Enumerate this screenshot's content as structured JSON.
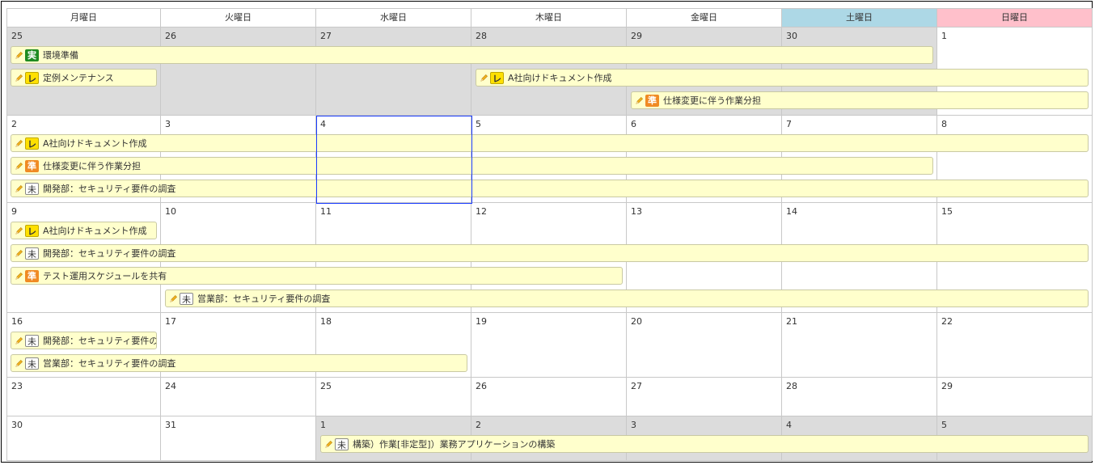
{
  "weekdays": [
    "月曜日",
    "火曜日",
    "水曜日",
    "木曜日",
    "金曜日",
    "土曜日",
    "日曜日"
  ],
  "colors": {
    "saturday": "#add8e6",
    "sunday": "#ffc0cb",
    "event_bg": "#ffffcc",
    "other_month": "#dcdcdc",
    "today_border": "#1a3cff"
  },
  "weeks": [
    {
      "days": [
        "25",
        "26",
        "27",
        "28",
        "29",
        "30",
        "1"
      ],
      "other": [
        true,
        true,
        true,
        true,
        true,
        true,
        false
      ]
    },
    {
      "days": [
        "2",
        "3",
        "4",
        "5",
        "6",
        "7",
        "8"
      ],
      "other": [
        false,
        false,
        false,
        false,
        false,
        false,
        false
      ]
    },
    {
      "days": [
        "9",
        "10",
        "11",
        "12",
        "13",
        "14",
        "15"
      ],
      "other": [
        false,
        false,
        false,
        false,
        false,
        false,
        false
      ]
    },
    {
      "days": [
        "16",
        "17",
        "18",
        "19",
        "20",
        "21",
        "22"
      ],
      "other": [
        false,
        false,
        false,
        false,
        false,
        false,
        false
      ]
    },
    {
      "days": [
        "23",
        "24",
        "25",
        "26",
        "27",
        "28",
        "29"
      ],
      "other": [
        false,
        false,
        false,
        false,
        false,
        false,
        false
      ]
    },
    {
      "days": [
        "30",
        "31",
        "1",
        "2",
        "3",
        "4",
        "5"
      ],
      "other": [
        false,
        false,
        true,
        true,
        true,
        true,
        true
      ]
    }
  ],
  "today": {
    "week": 1,
    "day": 2
  },
  "status_labels": {
    "jitsu": "実",
    "re": "レ",
    "jun": "準",
    "mi": "未"
  },
  "events": [
    {
      "week": 0,
      "lane": 0,
      "start": 0,
      "end": 5,
      "status": "jitsu",
      "title": "環境準備"
    },
    {
      "week": 0,
      "lane": 1,
      "start": 0,
      "end": 0,
      "status": "re",
      "title": "定例メンテナンス"
    },
    {
      "week": 0,
      "lane": 1,
      "start": 3,
      "end": 6,
      "status": "re",
      "title": "A社向けドキュメント作成"
    },
    {
      "week": 0,
      "lane": 2,
      "start": 4,
      "end": 6,
      "status": "jun",
      "title": "仕様変更に伴う作業分担"
    },
    {
      "week": 1,
      "lane": 0,
      "start": 0,
      "end": 6,
      "status": "re",
      "title": "A社向けドキュメント作成"
    },
    {
      "week": 1,
      "lane": 1,
      "start": 0,
      "end": 5,
      "status": "jun",
      "title": "仕様変更に伴う作業分担"
    },
    {
      "week": 1,
      "lane": 2,
      "start": 0,
      "end": 6,
      "status": "mi",
      "title": "開発部：セキュリティ要件の調査"
    },
    {
      "week": 2,
      "lane": 0,
      "start": 0,
      "end": 0,
      "status": "re",
      "title": "A社向けドキュメント作成"
    },
    {
      "week": 2,
      "lane": 1,
      "start": 0,
      "end": 6,
      "status": "mi",
      "title": "開発部：セキュリティ要件の調査"
    },
    {
      "week": 2,
      "lane": 2,
      "start": 0,
      "end": 3,
      "status": "jun",
      "title": "テスト運用スケジュールを共有"
    },
    {
      "week": 2,
      "lane": 3,
      "start": 1,
      "end": 6,
      "status": "mi",
      "title": "営業部：セキュリティ要件の調査"
    },
    {
      "week": 3,
      "lane": 0,
      "start": 0,
      "end": 0,
      "status": "mi",
      "title": "開発部：セキュリティ要件の調"
    },
    {
      "week": 3,
      "lane": 1,
      "start": 0,
      "end": 2,
      "status": "mi",
      "title": "営業部：セキュリティ要件の調査"
    },
    {
      "week": 5,
      "lane": 0,
      "start": 2,
      "end": 6,
      "status": "mi",
      "title": "構築）作業[非定型]）業務アプリケーションの構築"
    }
  ]
}
